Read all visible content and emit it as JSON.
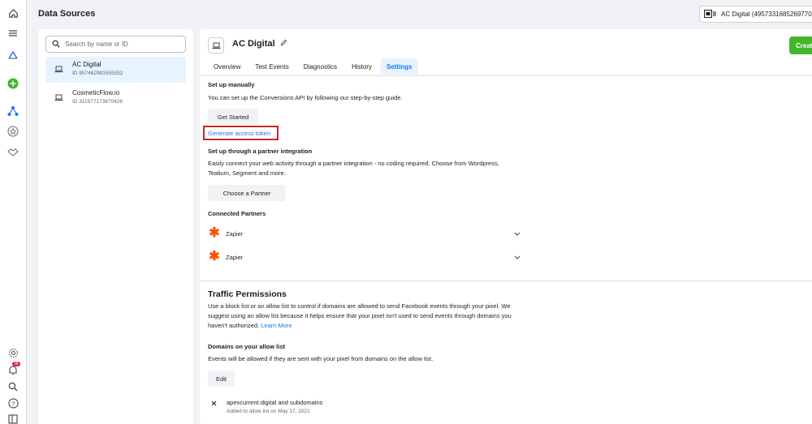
{
  "header": {
    "title": "Data Sources"
  },
  "account_selector": {
    "label": "AC Digital (4957331685269770"
  },
  "rail": {
    "icons": [
      "home-icon",
      "menu-icon",
      "meta-logo-icon",
      "add-icon",
      "data-sources-icon",
      "star-icon",
      "handshake-icon",
      "settings-icon",
      "notifications-icon",
      "search-icon",
      "help-icon",
      "panel-icon"
    ],
    "notification_count": "38"
  },
  "sidebar": {
    "search_placeholder": "Search by name or ID",
    "items": [
      {
        "name": "AC Digital",
        "id": "ID 957462981655352",
        "selected": true
      },
      {
        "name": "CosmeticFlow.io",
        "id": "ID 311577173670426",
        "selected": false
      }
    ]
  },
  "main": {
    "title": "AC Digital",
    "create_label": "Create",
    "tabs": [
      {
        "label": "Overview",
        "active": false
      },
      {
        "label": "Test Events",
        "active": false
      },
      {
        "label": "Diagnostics",
        "active": false
      },
      {
        "label": "History",
        "active": false
      },
      {
        "label": "Settings",
        "active": true
      }
    ],
    "setup_manual": {
      "heading": "Set up manually",
      "text": "You can set up the Conversions API by following our step-by-step guide.",
      "button": "Get Started",
      "token_link": "Generate access token"
    },
    "setup_partner": {
      "heading": "Set up through a partner integration",
      "text": "Easily connect your web activity through a partner integration - no coding required. Choose from Wordpress, Tealium, Segment and more.",
      "button": "Choose a Partner"
    },
    "connected": {
      "heading": "Connected Partners",
      "partners": [
        "Zapier",
        "Zapier"
      ]
    },
    "traffic": {
      "heading": "Traffic Permissions",
      "text": "Use a block list or an allow list to control if domains are allowed to send Facebook events through your pixel. We suggest using an allow list because it helps ensure that your pixel isn't used to send events through domains you haven't authorized.",
      "learn_more": "Learn More"
    },
    "allow_list": {
      "heading": "Domains on your allow list",
      "text": "Events will be allowed if they are sent with your pixel from domains on the allow list.",
      "button": "Edit",
      "domain": "apexcurrent.digital and subdomains",
      "added": "Added to allow list on May 17, 2021"
    }
  }
}
